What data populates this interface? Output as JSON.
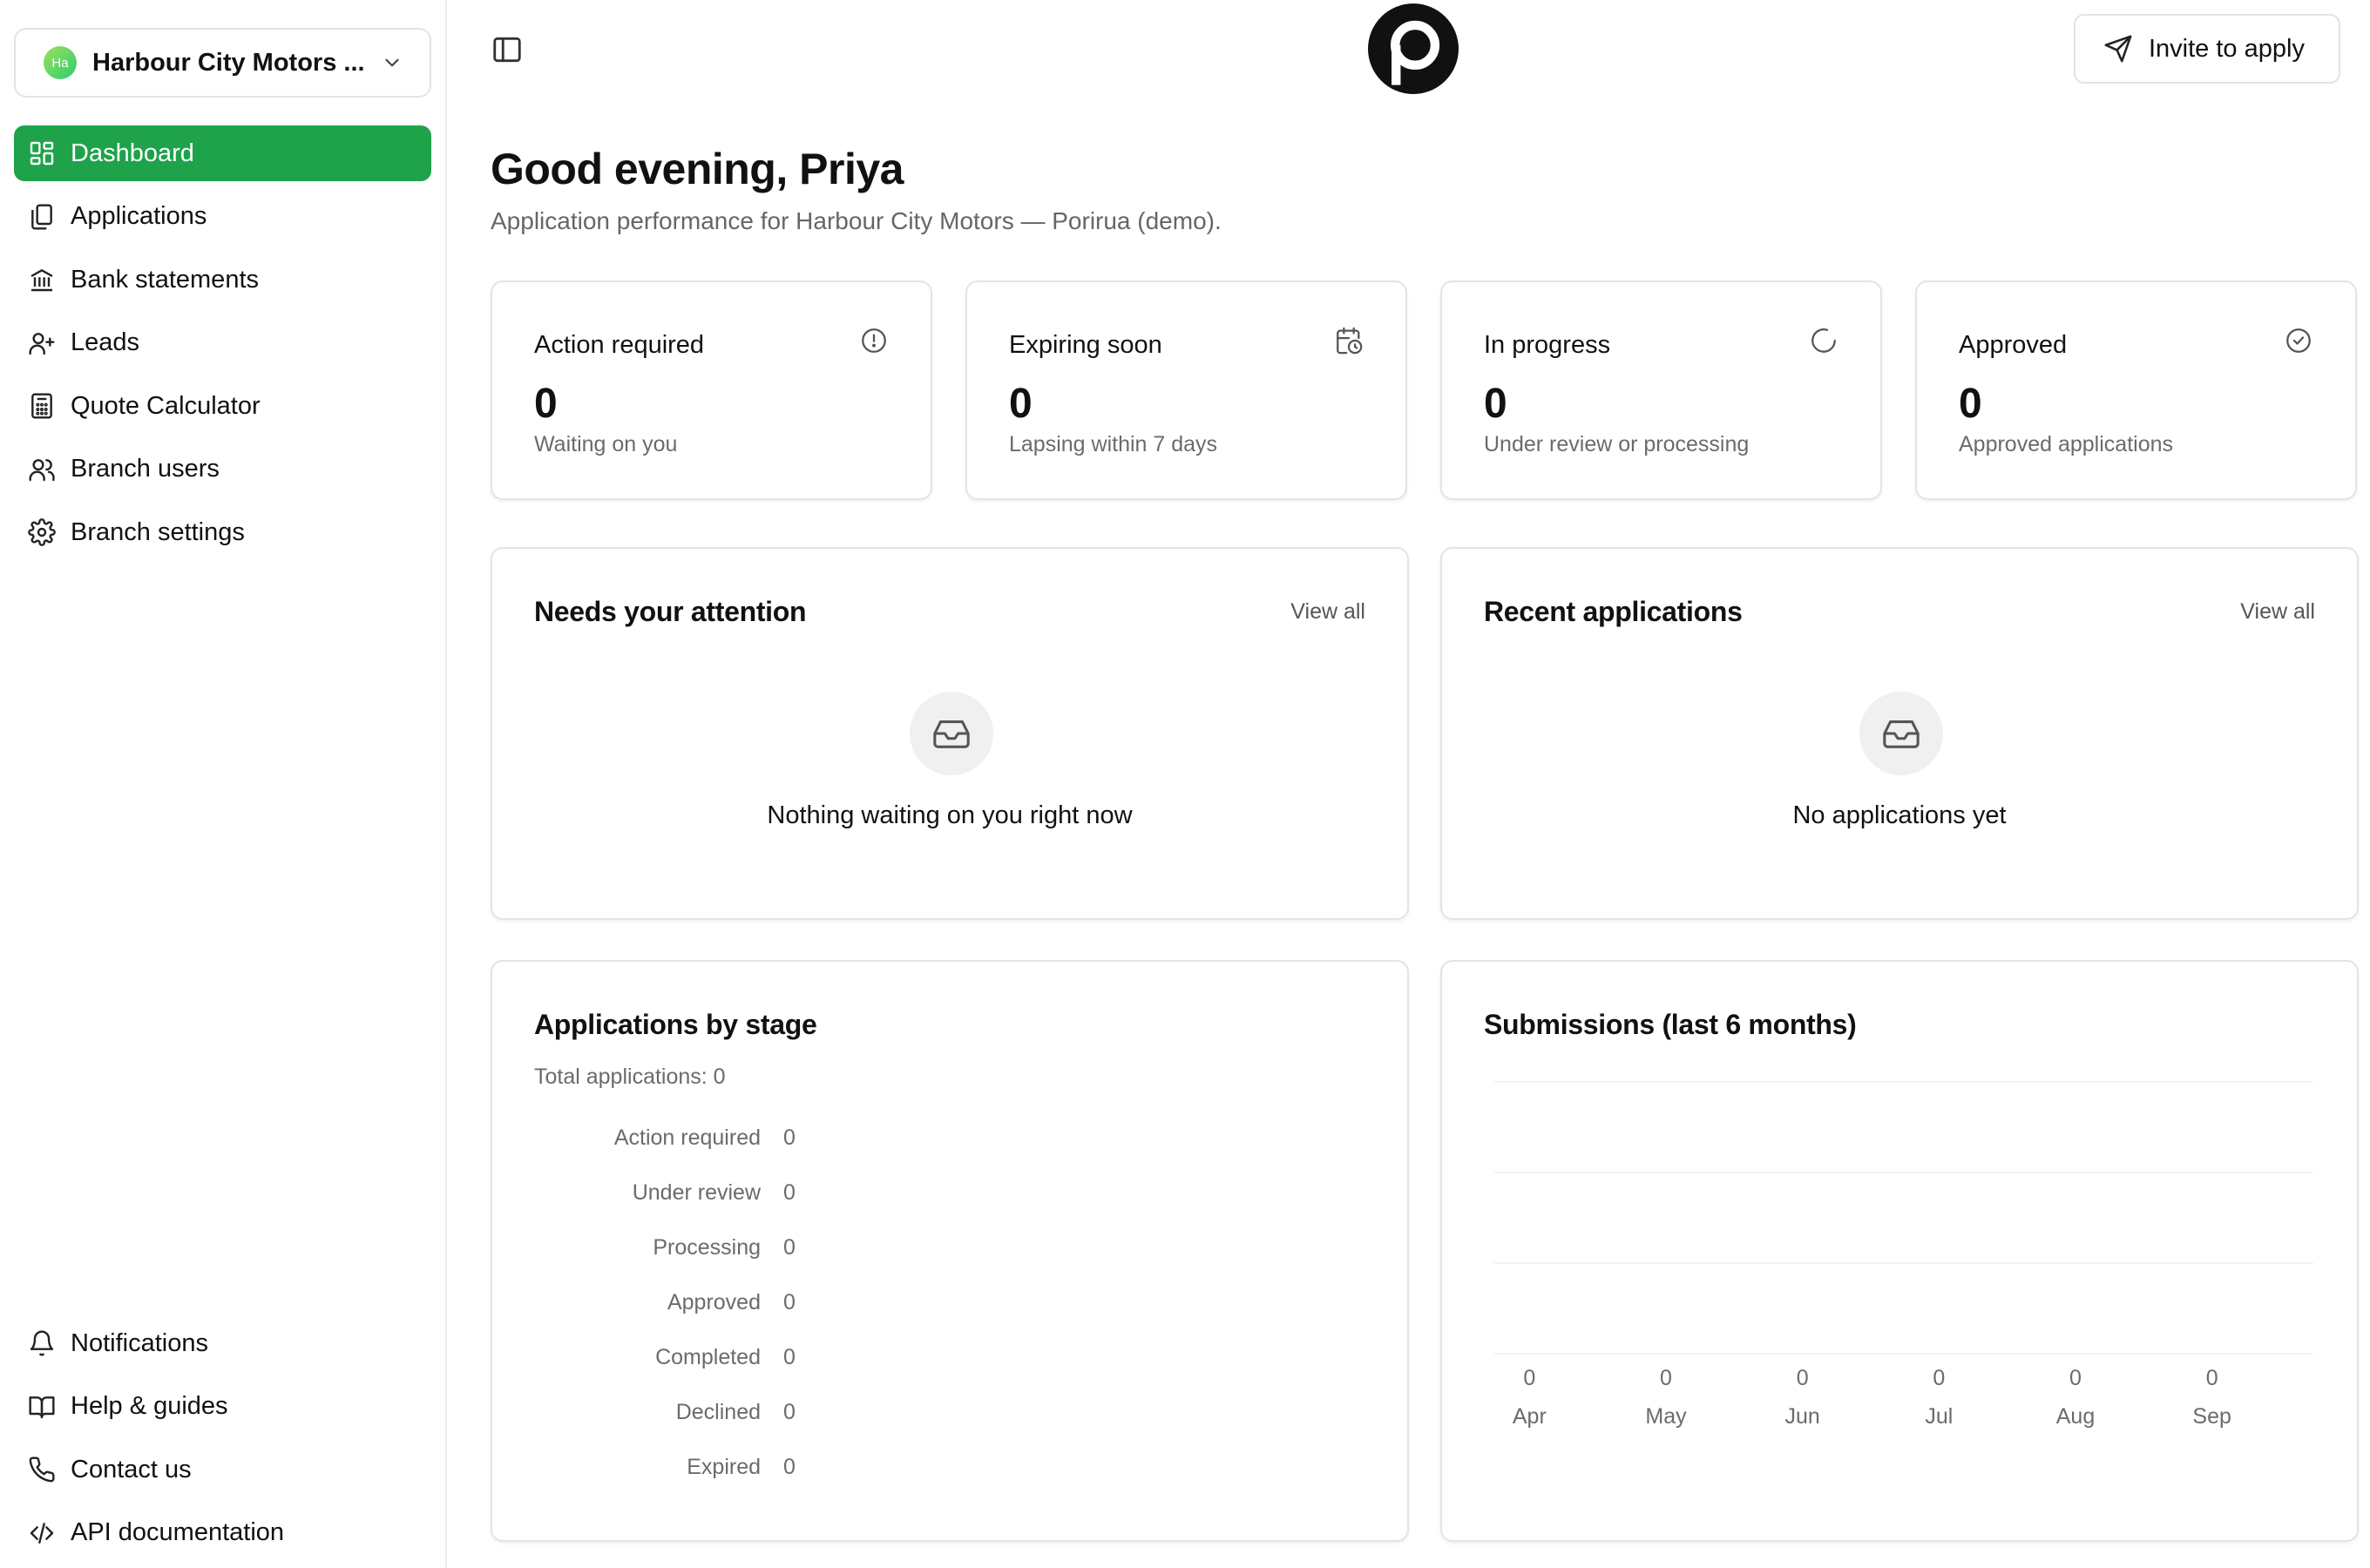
{
  "sidebar": {
    "branch": {
      "avatar": "Ha",
      "name": "Harbour City Motors ..."
    },
    "nav": [
      {
        "label": "Dashboard",
        "icon": "dashboard-icon",
        "active": true
      },
      {
        "label": "Applications",
        "icon": "applications-icon"
      },
      {
        "label": "Bank statements",
        "icon": "bank-icon"
      },
      {
        "label": "Leads",
        "icon": "user-plus-icon"
      },
      {
        "label": "Quote Calculator",
        "icon": "calculator-icon"
      },
      {
        "label": "Branch users",
        "icon": "users-icon"
      },
      {
        "label": "Branch settings",
        "icon": "gear-icon"
      }
    ],
    "bottom_nav": [
      {
        "label": "Notifications",
        "icon": "bell-icon"
      },
      {
        "label": "Help & guides",
        "icon": "book-icon"
      },
      {
        "label": "Contact us",
        "icon": "phone-icon"
      },
      {
        "label": "API documentation",
        "icon": "code-icon"
      }
    ]
  },
  "header": {
    "invite_label": "Invite to apply"
  },
  "main": {
    "greeting": "Good evening, Priya",
    "subtitle": "Application performance for Harbour City Motors — Porirua (demo).",
    "stats": [
      {
        "title": "Action required",
        "value": "0",
        "desc": "Waiting on you",
        "icon": "alert-circle-icon"
      },
      {
        "title": "Expiring soon",
        "value": "0",
        "desc": "Lapsing within 7 days",
        "icon": "calendar-clock-icon"
      },
      {
        "title": "In progress",
        "value": "0",
        "desc": "Under review or processing",
        "icon": "spinner-icon"
      },
      {
        "title": "Approved",
        "value": "0",
        "desc": "Approved applications",
        "icon": "check-circle-icon"
      }
    ],
    "attention": {
      "title": "Needs your attention",
      "view_all": "View all",
      "empty": "Nothing waiting on you right now"
    },
    "recent": {
      "title": "Recent applications",
      "view_all": "View all",
      "empty": "No applications yet"
    },
    "stages": {
      "title": "Applications by stage",
      "total": "Total applications: 0",
      "rows": [
        {
          "name": "Action required",
          "count": "0"
        },
        {
          "name": "Under review",
          "count": "0"
        },
        {
          "name": "Processing",
          "count": "0"
        },
        {
          "name": "Approved",
          "count": "0"
        },
        {
          "name": "Completed",
          "count": "0"
        },
        {
          "name": "Declined",
          "count": "0"
        },
        {
          "name": "Expired",
          "count": "0"
        }
      ]
    },
    "submissions": {
      "title": "Submissions (last 6 months)"
    }
  },
  "chart_data": {
    "type": "bar",
    "title": "Submissions (last 6 months)",
    "categories": [
      "Apr",
      "May",
      "Jun",
      "Jul",
      "Aug",
      "Sep"
    ],
    "values": [
      0,
      0,
      0,
      0,
      0,
      0
    ],
    "xlabel": "",
    "ylabel": "",
    "grid": true
  }
}
